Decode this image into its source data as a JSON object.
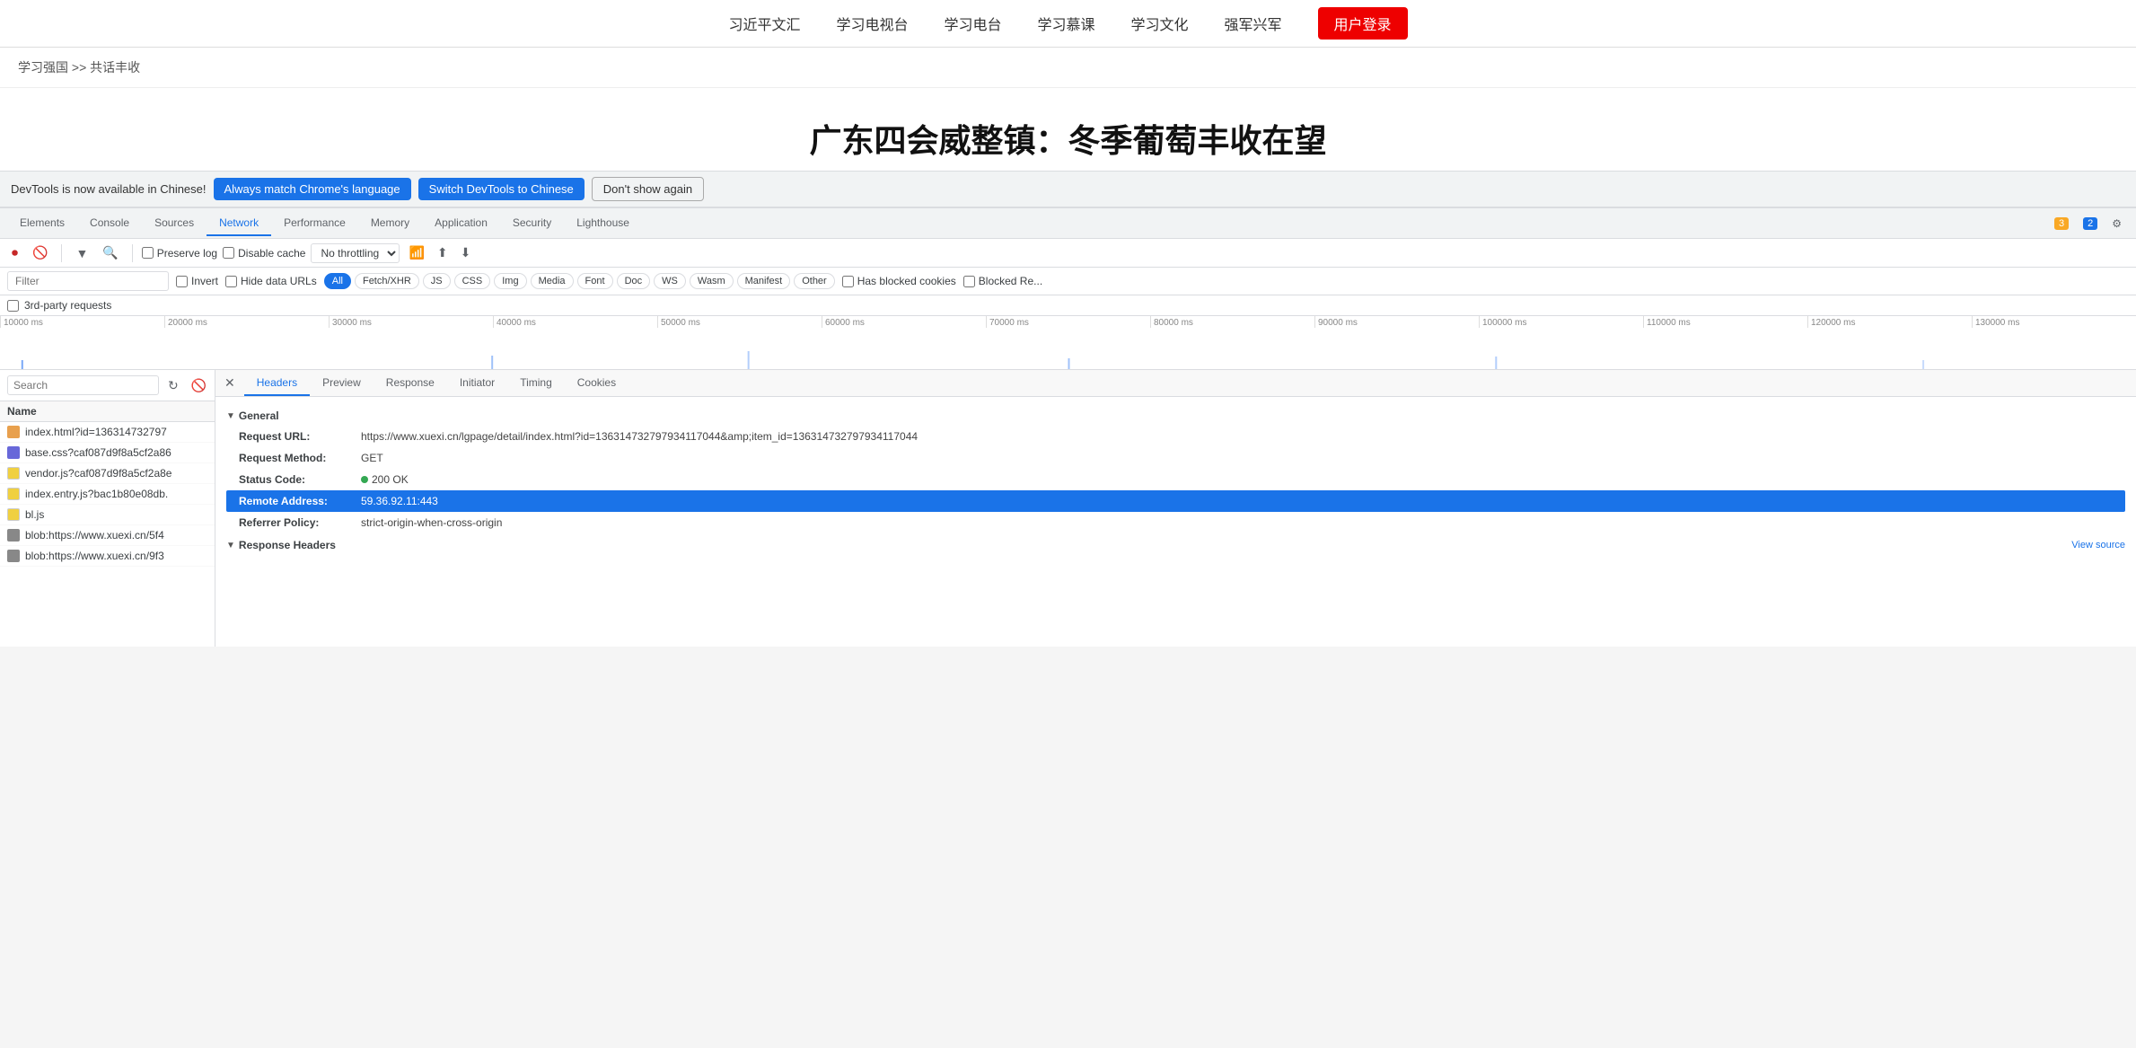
{
  "topnav": {
    "items": [
      {
        "label": "习近平文汇"
      },
      {
        "label": "学习电视台"
      },
      {
        "label": "学习电台"
      },
      {
        "label": "学习慕课"
      },
      {
        "label": "学习文化"
      },
      {
        "label": "强军兴军"
      }
    ],
    "login_label": "用户登录"
  },
  "breadcrumb": "学习强国 >> 共话丰收",
  "page_title": "广东四会威整镇：冬季葡萄丰收在望",
  "devtools_notification": {
    "text": "DevTools is now available in Chinese!",
    "btn1": "Always match Chrome's language",
    "btn2": "Switch DevTools to Chinese",
    "btn3": "Don't show again"
  },
  "devtools_tabs": {
    "items": [
      "Elements",
      "Console",
      "Sources",
      "Network",
      "Performance",
      "Memory",
      "Application",
      "Security",
      "Lighthouse"
    ],
    "active": "Network",
    "warning_count": "3",
    "info_count": "2"
  },
  "network_toolbar": {
    "preserve_log": "Preserve log",
    "disable_cache": "Disable cache",
    "throttle": "No throttling"
  },
  "filter_bar": {
    "placeholder": "Filter",
    "invert": "Invert",
    "hide_data_urls": "Hide data URLs",
    "types": [
      "All",
      "Fetch/XHR",
      "JS",
      "CSS",
      "Img",
      "Media",
      "Font",
      "Doc",
      "WS",
      "Wasm",
      "Manifest",
      "Other"
    ],
    "active_type": "All",
    "has_blocked": "Has blocked cookies",
    "blocked_re": "Blocked Re..."
  },
  "third_party": "3rd-party requests",
  "timeline": {
    "ticks": [
      "10000 ms",
      "20000 ms",
      "30000 ms",
      "40000 ms",
      "50000 ms",
      "60000 ms",
      "70000 ms",
      "80000 ms",
      "90000 ms",
      "100000 ms",
      "110000 ms",
      "120000 ms",
      "130000 ms"
    ]
  },
  "search": {
    "placeholder": "Search",
    "label": "Search"
  },
  "file_list": {
    "headers": [
      "Name"
    ],
    "items": [
      {
        "name": "index.html?id=136314732797",
        "type": "html"
      },
      {
        "name": "base.css?caf087d9f8a5cf2a86",
        "type": "css"
      },
      {
        "name": "vendor.js?caf087d9f8a5cf2a8e",
        "type": "js"
      },
      {
        "name": "index.entry.js?bac1b80e08db.",
        "type": "js"
      },
      {
        "name": "bl.js",
        "type": "js"
      },
      {
        "name": "blob:https://www.xuexi.cn/5f4",
        "type": "blob"
      },
      {
        "name": "blob:https://www.xuexi.cn/9f3",
        "type": "blob"
      }
    ]
  },
  "details_tabs": {
    "items": [
      "Headers",
      "Preview",
      "Response",
      "Initiator",
      "Timing",
      "Cookies"
    ],
    "active": "Headers"
  },
  "general_section": {
    "title": "General",
    "rows": [
      {
        "label": "Request URL:",
        "value": "https://www.xuexi.cn/lgpage/detail/index.html?id=136314732797934117044&amp;item_id=136314732797934117044",
        "highlighted": false
      },
      {
        "label": "Request Method:",
        "value": "GET",
        "highlighted": false
      },
      {
        "label": "Status Code:",
        "value": "200 OK",
        "status_dot": true,
        "highlighted": false
      },
      {
        "label": "Remote Address:",
        "value": "59.36.92.11:443",
        "highlighted": true
      },
      {
        "label": "Referrer Policy:",
        "value": "strict-origin-when-cross-origin",
        "highlighted": false
      }
    ]
  },
  "response_headers": {
    "title": "Response Headers",
    "view_source": "View source"
  }
}
